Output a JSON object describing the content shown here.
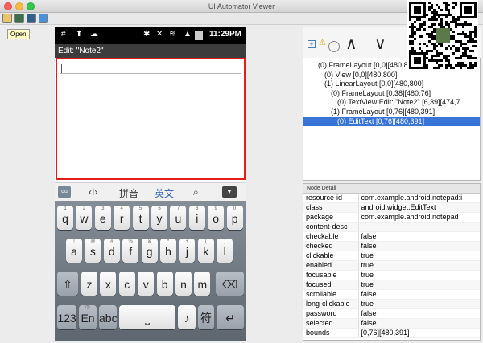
{
  "window": {
    "title": "UI Automator Viewer",
    "tooltip": "Open"
  },
  "device": {
    "status_time": "11:29PM",
    "app_title": "Edit: \"Note2\"",
    "candidate_bar": {
      "pinyin": "拼音",
      "english": "英文"
    },
    "keyboard": {
      "row1": [
        [
          "1",
          "q"
        ],
        [
          "2",
          "w"
        ],
        [
          "3",
          "e"
        ],
        [
          "4",
          "r"
        ],
        [
          "5",
          "t"
        ],
        [
          "6",
          "y"
        ],
        [
          "7",
          "u"
        ],
        [
          "8",
          "i"
        ],
        [
          "9",
          "o"
        ],
        [
          "0",
          "p"
        ]
      ],
      "row2": [
        [
          "!",
          "a"
        ],
        [
          "@",
          "s"
        ],
        [
          "#",
          "d"
        ],
        [
          "%",
          "f"
        ],
        [
          "&",
          "g"
        ],
        [
          "*",
          "h"
        ],
        [
          "+",
          "j"
        ],
        [
          "(",
          "k"
        ],
        [
          ")",
          "l"
        ]
      ],
      "row3": [
        [
          "",
          "z"
        ],
        [
          "",
          "x"
        ],
        [
          "",
          "c"
        ],
        [
          "",
          "v"
        ],
        [
          "",
          "b"
        ],
        [
          "",
          "n"
        ],
        [
          "",
          "m"
        ]
      ],
      "row4_123": "123",
      "row4_lang_top": "中",
      "row4_lang": "En",
      "row4_abc": "abc",
      "row4_symbol": "符"
    }
  },
  "tree": {
    "nodes": [
      {
        "text": "(0) FrameLayout [0,0][480,800]",
        "indent": 0,
        "selected": false
      },
      {
        "text": "(0) View [0,0][480,800]",
        "indent": 1,
        "selected": false
      },
      {
        "text": "(1) LinearLayout [0,0][480,800]",
        "indent": 1,
        "selected": false
      },
      {
        "text": "(0) FrameLayout [0,38][480,76]",
        "indent": 2,
        "selected": false
      },
      {
        "text": "(0) TextView:Edit: \"Note2\" [6,39][474,7",
        "indent": 3,
        "selected": false
      },
      {
        "text": "(1) FrameLayout [0,76][480,391]",
        "indent": 2,
        "selected": false
      },
      {
        "text": "(0) EditText [0,76][480,391]",
        "indent": 3,
        "selected": true
      }
    ]
  },
  "detail": {
    "header": "Node Detail",
    "rows": [
      [
        "resource-id",
        "com.example.android.notepad:i"
      ],
      [
        "class",
        "android.widget.EditText"
      ],
      [
        "package",
        "com.example.android.notepad"
      ],
      [
        "content-desc",
        ""
      ],
      [
        "checkable",
        "false"
      ],
      [
        "checked",
        "false"
      ],
      [
        "clickable",
        "true"
      ],
      [
        "enabled",
        "true"
      ],
      [
        "focusable",
        "true"
      ],
      [
        "focused",
        "true"
      ],
      [
        "scrollable",
        "false"
      ],
      [
        "long-clickable",
        "true"
      ],
      [
        "password",
        "false"
      ],
      [
        "selected",
        "false"
      ],
      [
        "bounds",
        "[0,76][480,391]"
      ]
    ]
  },
  "colors": {
    "selection": "#3875d7",
    "edit_border": "#e41c1c"
  }
}
